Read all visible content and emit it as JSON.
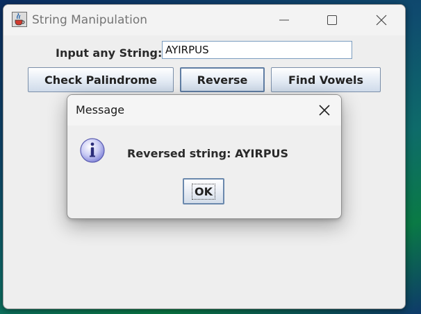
{
  "window": {
    "title": "String Manipulation",
    "icon": "java-cup-icon"
  },
  "form": {
    "input_label": "Input any String:",
    "input_value": "AYIRPUS"
  },
  "buttons": {
    "check_palindrome": "Check Palindrome",
    "reverse": "Reverse",
    "find_vowels": "Find Vowels"
  },
  "dialog": {
    "title": "Message",
    "icon": "info-icon",
    "message": "Reversed string: AYIRPUS",
    "ok_label": "OK"
  },
  "colors": {
    "desktop_start": "#0b2f63",
    "desktop_end": "#0a7a45",
    "window_bg": "#eeeeee",
    "button_border": "#7a8ea8",
    "info_icon": "#7c7fd6"
  }
}
